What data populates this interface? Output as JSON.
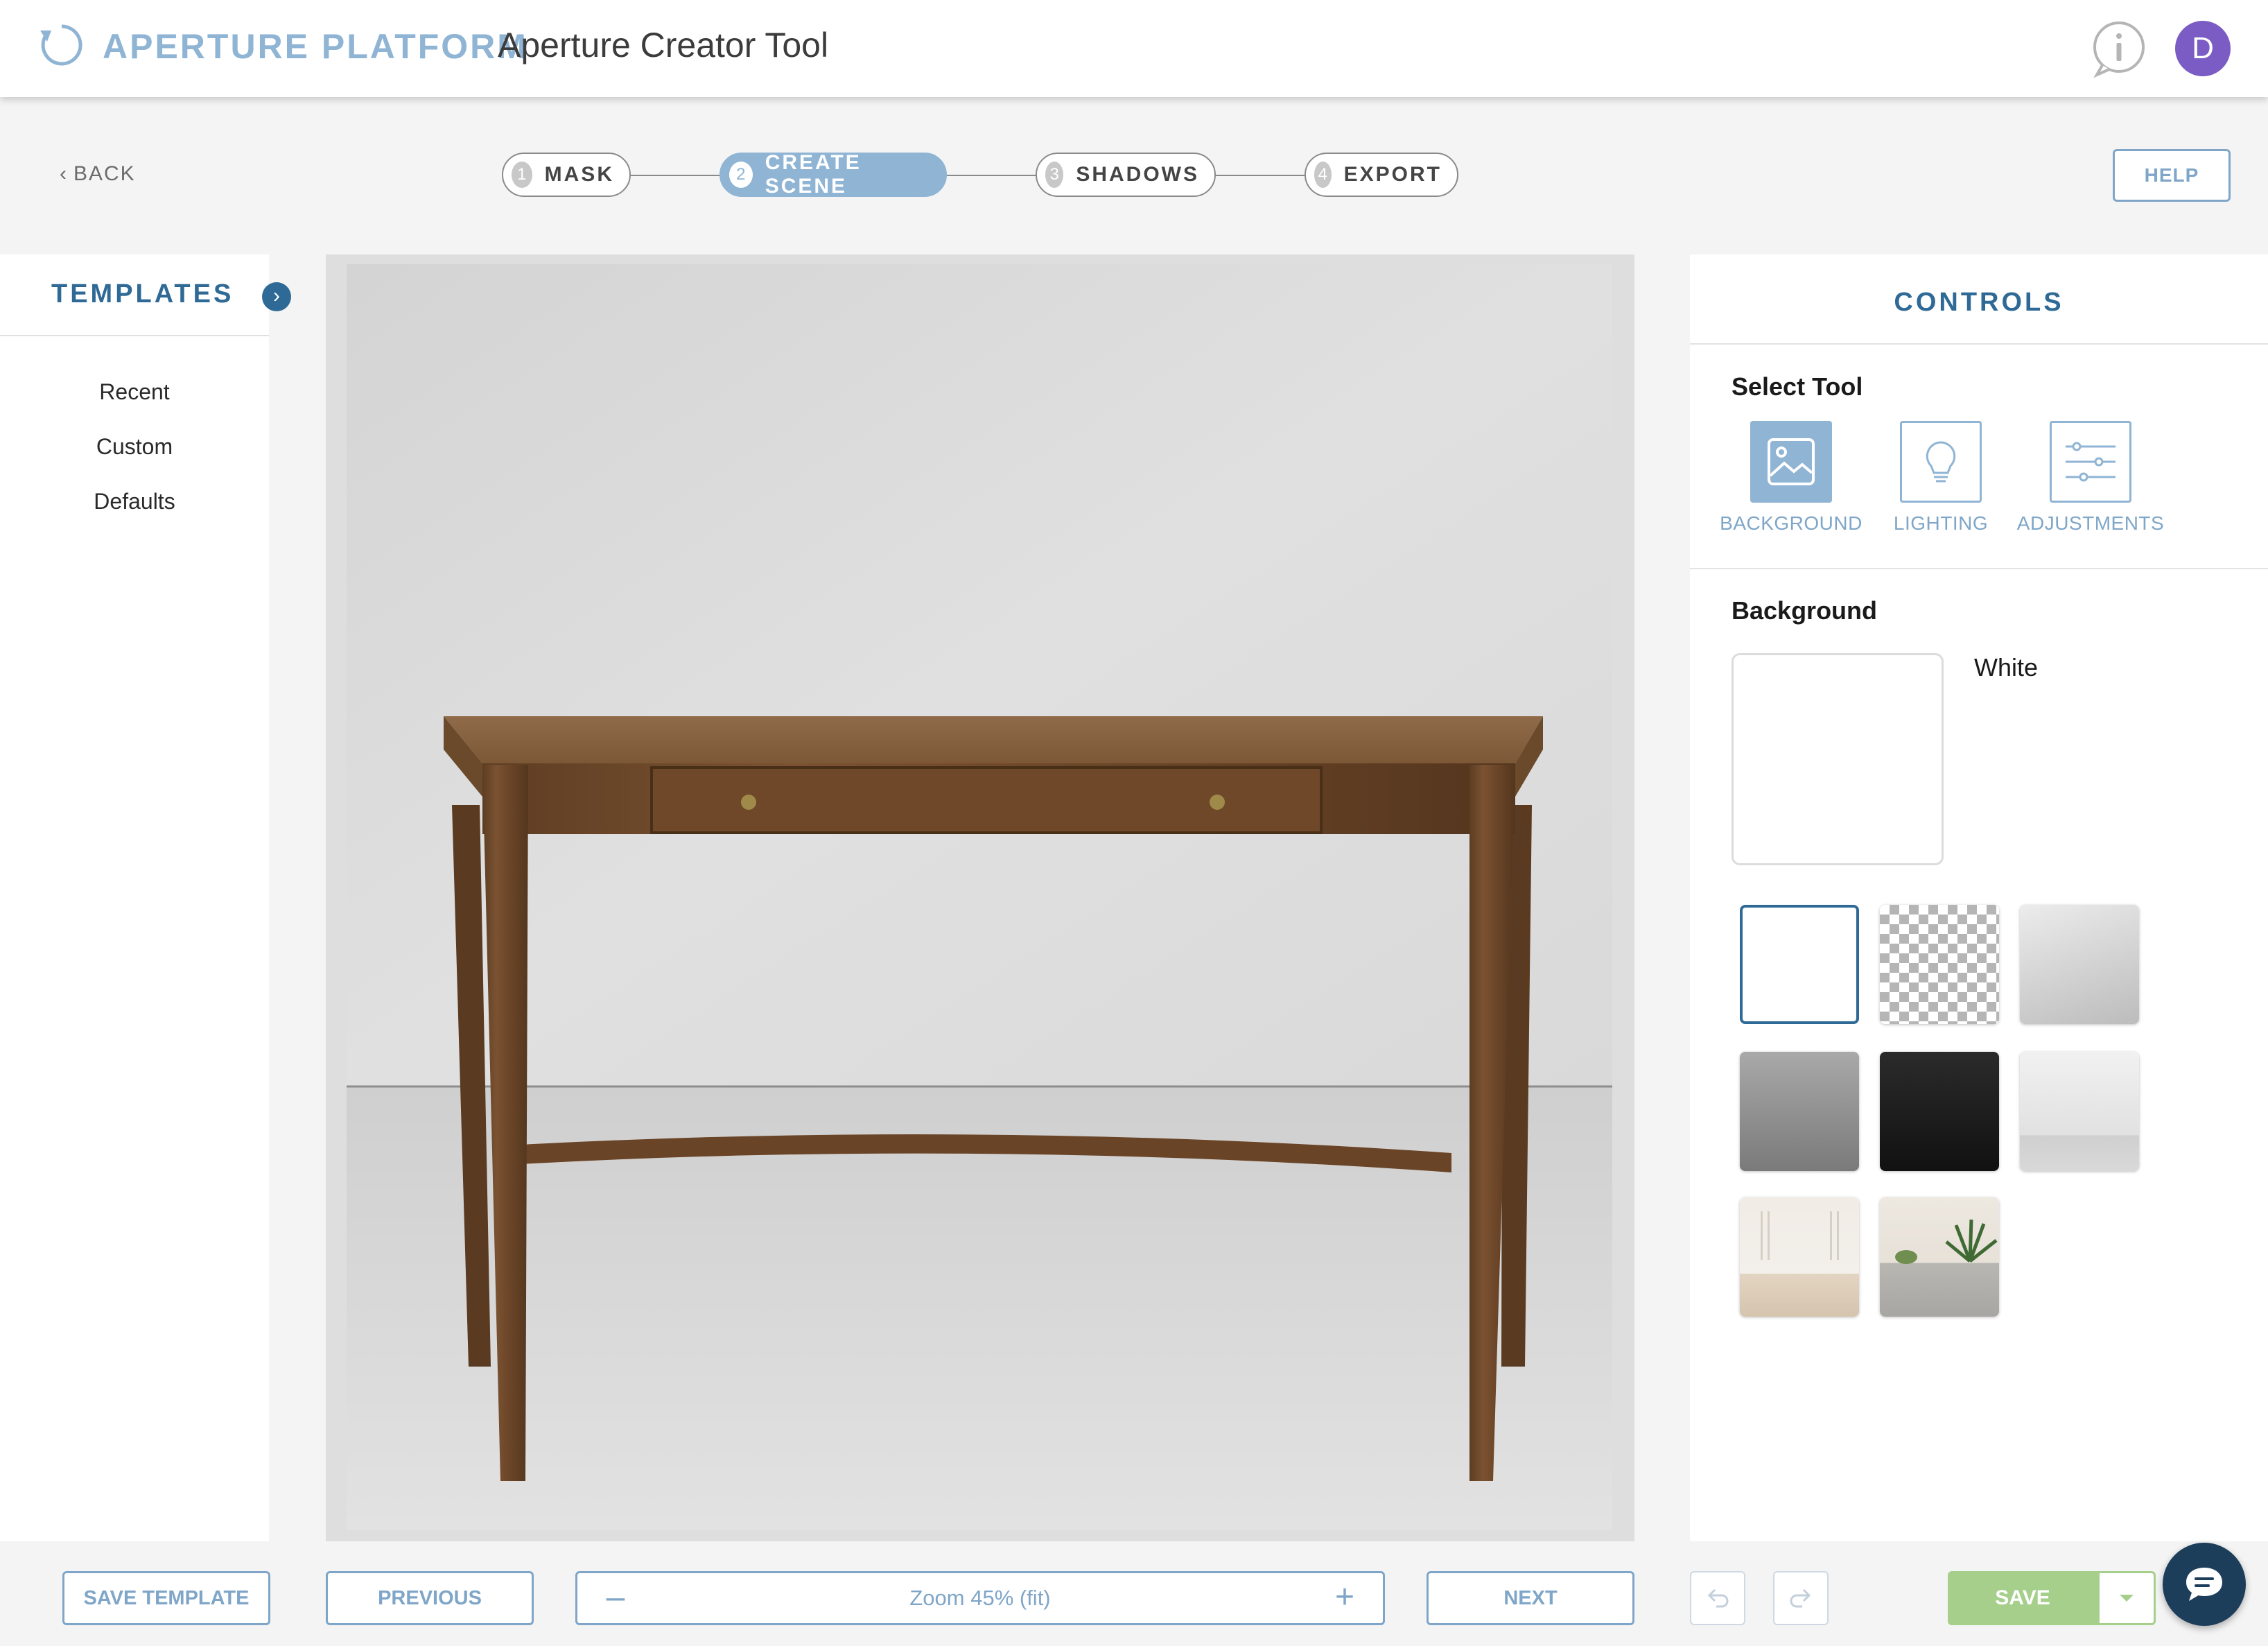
{
  "header": {
    "brand": "APERTURE PLATFORM",
    "app_title": "Aperture Creator Tool",
    "avatar_initial": "D",
    "icons": {
      "brand": "refresh-circle-icon",
      "info": "info-icon"
    }
  },
  "nav": {
    "back_label": "BACK",
    "help_label": "HELP",
    "steps": [
      {
        "number": "1",
        "label": "MASK",
        "active": false
      },
      {
        "number": "2",
        "label": "CREATE SCENE",
        "active": true
      },
      {
        "number": "3",
        "label": "SHADOWS",
        "active": false
      },
      {
        "number": "4",
        "label": "EXPORT",
        "active": false
      }
    ]
  },
  "templates": {
    "title": "TEMPLATES",
    "items": [
      "Recent",
      "Custom",
      "Defaults"
    ]
  },
  "controls": {
    "title": "CONTROLS",
    "select_tool_label": "Select Tool",
    "tools": [
      {
        "label": "BACKGROUND",
        "icon": "image-icon",
        "selected": true
      },
      {
        "label": "LIGHTING",
        "icon": "lightbulb-icon",
        "selected": false
      },
      {
        "label": "ADJUSTMENTS",
        "icon": "sliders-icon",
        "selected": false
      }
    ],
    "background_label": "Background",
    "selected_background": "White",
    "swatches": [
      "white",
      "transparent",
      "light-gray-gradient",
      "gray-gradient",
      "black",
      "light-studio",
      "white-room",
      "patio"
    ]
  },
  "footer": {
    "save_template_label": "SAVE TEMPLATE",
    "previous_label": "PREVIOUS",
    "zoom_label": "Zoom 45% (fit)",
    "next_label": "NEXT",
    "save_label": "SAVE"
  },
  "colors": {
    "accent": "#8fb4d4",
    "accent_dark": "#2f6a96",
    "save_green": "#a5cf8b",
    "avatar": "#7b5cc4"
  }
}
